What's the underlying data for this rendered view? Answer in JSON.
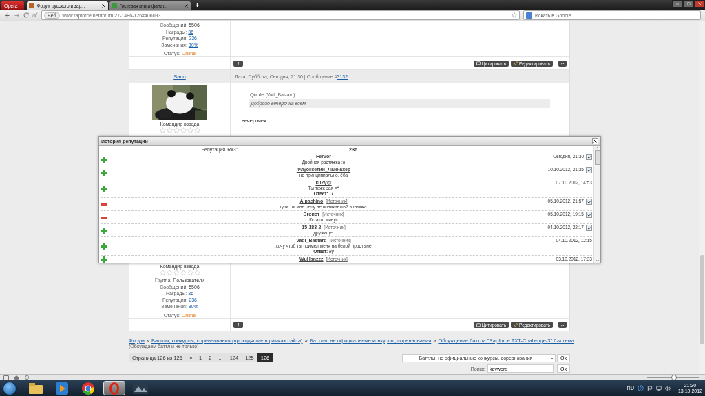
{
  "browser": {
    "menu_button": "Opera",
    "tabs": [
      {
        "title": "Форум русского и зар...",
        "selected": true
      },
      {
        "title": "Гостевая книга фанат...",
        "selected": false
      }
    ],
    "new_tab": "+",
    "address": {
      "badge": "Веб",
      "url": "www.rapforce.net/forum/27-1486-126#406093"
    },
    "search": {
      "placeholder": "Искать в Google"
    }
  },
  "prev_post": {
    "stats": [
      {
        "label": "Сообщений:",
        "value": "5506",
        "kind": "text"
      },
      {
        "label": "Награды:",
        "value": "36",
        "kind": "link"
      },
      {
        "label": "Репутация:",
        "value": "236",
        "kind": "link"
      },
      {
        "label": "Замечания:",
        "value": "80%",
        "kind": "link"
      },
      {
        "label": "Статус:",
        "value": "Online",
        "kind": "status"
      }
    ],
    "actions": {
      "info": "i",
      "quote": "Цитировать",
      "edit": "Редактировать"
    }
  },
  "post": {
    "author": "Sano",
    "date": "Дата: Суббота, Сегодня, 21:30 | Сообщение # ",
    "number": "3132",
    "rank": "Командир взвода",
    "stars": 0,
    "quote": {
      "label": "Quote",
      "author": "(Vadi_Bastard)",
      "text": "Доброго вечерочка всем"
    },
    "message": "вечерочек"
  },
  "next_post": {
    "rank": "Командир взвода",
    "stars": 0,
    "stats": [
      {
        "label": "Группа:",
        "value": "Пользователи",
        "kind": "text"
      },
      {
        "label": "Сообщений:",
        "value": "5506",
        "kind": "text"
      },
      {
        "label": "Награды:",
        "value": "36",
        "kind": "link"
      },
      {
        "label": "Репутация:",
        "value": "236",
        "kind": "link"
      },
      {
        "label": "Замечания:",
        "value": "80%",
        "kind": "link"
      },
      {
        "label": "Статус:",
        "value": "Online",
        "kind": "status"
      }
    ],
    "actions": {
      "info": "i",
      "quote": "Цитировать",
      "edit": "Редактировать"
    }
  },
  "breadcrumb": {
    "items": [
      "Форум",
      "Баттлы, конкурсы, соревнования (проходящие в рамках сайта)",
      "Баттлы, не официальные конкурсы, соревнования",
      "Обсуждение баттла \"Rapforce TXT-Challenge-3\" 6-я тема"
    ],
    "separator": "»",
    "subtitle": "(Обсуждаем баттл и не только)"
  },
  "pagination": {
    "label": "Страница 126 из 126",
    "pages": [
      {
        "text": "«",
        "selected": false
      },
      {
        "text": "1",
        "selected": false
      },
      {
        "text": "2",
        "selected": false
      },
      {
        "text": "...",
        "selected": false
      },
      {
        "text": "124",
        "selected": false
      },
      {
        "text": "125",
        "selected": false
      },
      {
        "text": "126",
        "selected": true
      }
    ],
    "forum_select": "Баттлы, не официальные конкурсы, соревнования",
    "ok": "Ok"
  },
  "search_form": {
    "label": "Поиск:",
    "value": "keyword",
    "ok": "Ok"
  },
  "reputation_dialog": {
    "title": "История репутации",
    "label": "Репутация 'Rx3':",
    "total": "236",
    "entries": [
      {
        "kind": "plus",
        "author": "Fervor",
        "date": "Сегодня, 21:30",
        "confirmed": true,
        "comment": "Двойная растяжка :o"
      },
      {
        "kind": "plus",
        "author": "Флуоксетин_Ланнахер",
        "date": "10.10.2012, 21:35",
        "confirmed": true,
        "comment": "не принципиально, ёба"
      },
      {
        "kind": "plus",
        "author": "kuZy@",
        "date": "07.10.2012, 14:53",
        "confirmed": false,
        "comment": "Ты тоже зая =*",
        "reply": "**Ответ: :7**"
      },
      {
        "kind": "minus",
        "author": "Alpachino",
        "source": "[Источник]",
        "date": "05.10.2012, 21:57",
        "confirmed": true,
        "comment": "хули ты мне репу не поникаешь? вонючка."
      },
      {
        "kind": "minus",
        "author": "Эгоист",
        "source": "[Источник]",
        "date": "05.10.2012, 19:15",
        "confirmed": true,
        "comment": "Кстати, минус"
      },
      {
        "kind": "plus",
        "author": "15-183-2",
        "source": "[Источник]",
        "date": "04.10.2012, 22:17",
        "confirmed": true,
        "comment": "дружище!"
      },
      {
        "kind": "plus",
        "author": "Vadi_Bastard",
        "source": "[Источник]",
        "date": "04.10.2012, 12:15",
        "confirmed": false,
        "comment": "хочу чтоб ты поимел меня на белой простыне",
        "reply": "**Ответ:** *ну*"
      },
      {
        "kind": "plus",
        "author": "WuHanzzz",
        "source": "[Источник]",
        "date": "03.10.2012, 17:33",
        "confirmed": false
      }
    ]
  },
  "status_bar": {
    "zoom": {
      "level": 0.5
    }
  },
  "taskbar": {
    "apps": [
      {
        "kind": "folder",
        "selected": false
      },
      {
        "kind": "media",
        "selected": false
      },
      {
        "kind": "chrome",
        "selected": false
      },
      {
        "kind": "opera",
        "selected": true
      },
      {
        "kind": "app",
        "selected": false
      }
    ],
    "language": "RU",
    "time": "21:30",
    "date": "13.10.2012"
  }
}
